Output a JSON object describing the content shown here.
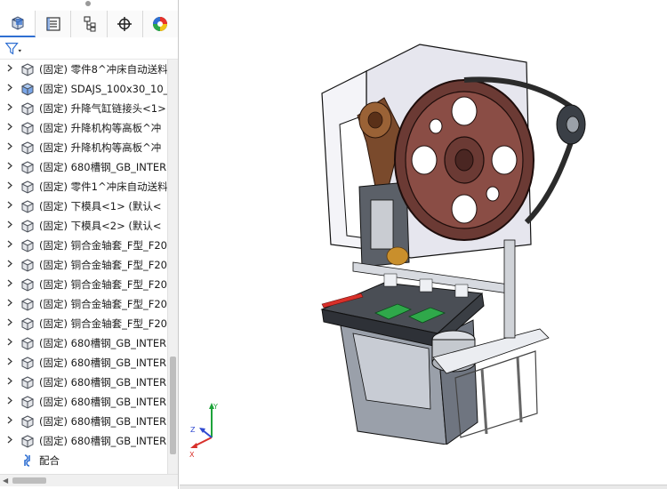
{
  "left_panel": {
    "tabs": [
      {
        "name": "feature-manager-tab",
        "icon": "feature-manager-icon",
        "active": true
      },
      {
        "name": "property-manager-tab",
        "icon": "property-manager-icon",
        "active": false
      },
      {
        "name": "configuration-manager-tab",
        "icon": "configuration-manager-icon",
        "active": false
      },
      {
        "name": "dimxpert-manager-tab",
        "icon": "crosshair-icon",
        "active": false
      },
      {
        "name": "display-manager-tab",
        "icon": "appearance-icon",
        "active": false
      }
    ],
    "filter_icon": "filter-icon",
    "tree_items": [
      {
        "label": "(固定) 零件8^冲床自动送料"
      },
      {
        "label": "(固定) SDAJS_100x30_10_",
        "icon_color": "blue"
      },
      {
        "label": "(固定) 升降气缸链接头<1>"
      },
      {
        "label": "(固定) 升降机构等高板^冲"
      },
      {
        "label": "(固定) 升降机构等高板^冲"
      },
      {
        "label": "(固定) 680槽钢_GB_INTER"
      },
      {
        "label": "(固定) 零件1^冲床自动送料"
      },
      {
        "label": "(固定) 下模具<1> (默认<"
      },
      {
        "label": "(固定) 下模具<2> (默认<"
      },
      {
        "label": "(固定) 铜合金轴套_F型_F20"
      },
      {
        "label": "(固定) 铜合金轴套_F型_F20"
      },
      {
        "label": "(固定) 铜合金轴套_F型_F20"
      },
      {
        "label": "(固定) 铜合金轴套_F型_F20"
      },
      {
        "label": "(固定) 铜合金轴套_F型_F20"
      },
      {
        "label": "(固定) 680槽钢_GB_INTER"
      },
      {
        "label": "(固定) 680槽钢_GB_INTER"
      },
      {
        "label": "(固定) 680槽钢_GB_INTER"
      },
      {
        "label": "(固定) 680槽钢_GB_INTER"
      },
      {
        "label": "(固定) 680槽钢_GB_INTER"
      },
      {
        "label": "(固定) 680槽钢_GB_INTER"
      }
    ],
    "mates": {
      "label": "配合",
      "icon": "mates-icon"
    }
  },
  "viewport": {
    "model": "punch-press-assembly",
    "triad": {
      "x_label": "X",
      "y_label": "Y",
      "z_label": "Z"
    }
  },
  "colors": {
    "accent": "#2f6fd2",
    "flywheel": "#6b3a34",
    "frame": "#e6e6ee",
    "green_parts": "#2fa84a"
  }
}
